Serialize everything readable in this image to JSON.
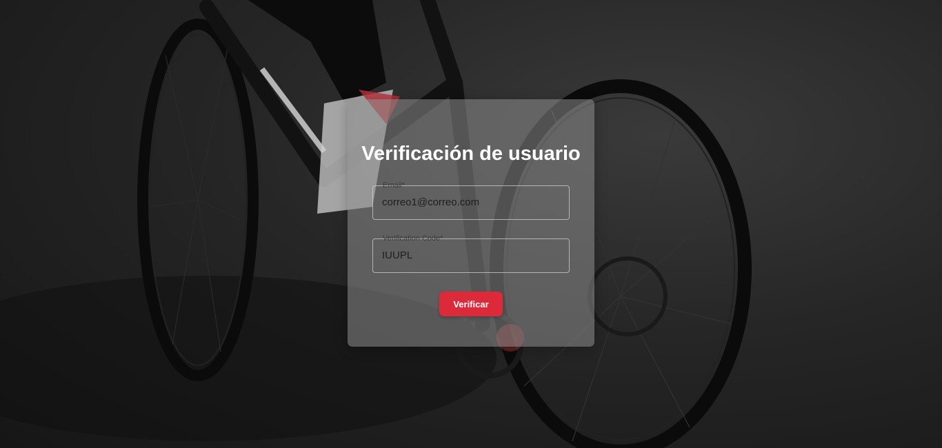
{
  "page": {
    "title": "Verificación de usuario",
    "background": "cyclist-on-gravel-photo",
    "accent_color": "#dc2a3a"
  },
  "form": {
    "email": {
      "label": "Email*",
      "value": "correo1@correo.com"
    },
    "code": {
      "label": "Verification Code*",
      "value": "IUUPL"
    },
    "submit_label": "Verificar"
  }
}
